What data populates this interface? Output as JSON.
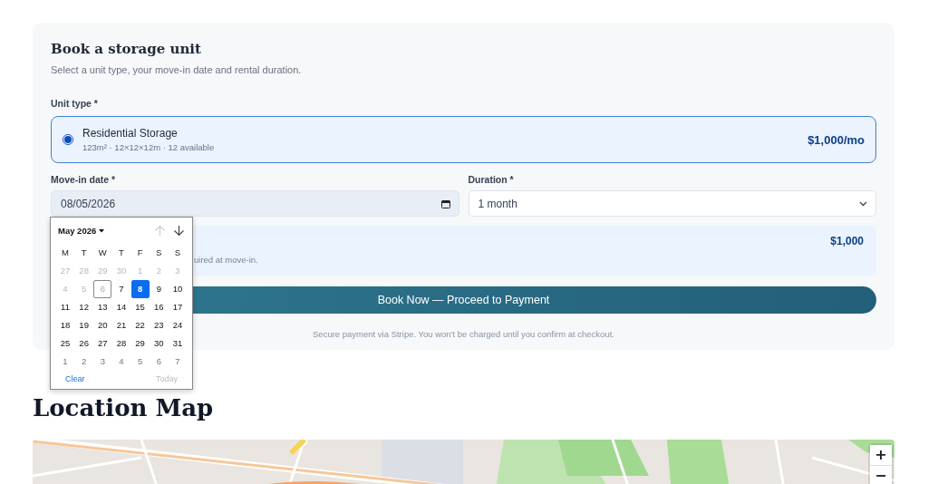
{
  "booking": {
    "title": "Book a storage unit",
    "subtitle": "Select a unit type, your move-in date and rental duration.",
    "unit_type": {
      "label": "Unit type *",
      "options": [
        {
          "name": "Residential Storage",
          "details": "123m² · 12×12×12m · 12 available",
          "price": "$1,000/mo",
          "selected": true
        }
      ]
    },
    "move_in": {
      "label": "Move-in date *",
      "value": "08/05/2026"
    },
    "duration": {
      "label": "Duration *",
      "value": "1 month"
    },
    "summary": {
      "note": "uired at move-in.",
      "total": "$1,000"
    },
    "submit": {
      "label": "Book Now — Proceed to Payment"
    },
    "footnote": "Secure payment via Stripe. You won't be charged until you confirm at checkout."
  },
  "calendar": {
    "month": "May 2026",
    "up_disabled": true,
    "down_disabled": false,
    "weekdays": [
      "M",
      "T",
      "W",
      "T",
      "F",
      "S",
      "S"
    ],
    "days": [
      {
        "label": "27",
        "kind": "disabled",
        "selected": false
      },
      {
        "label": "28",
        "kind": "disabled",
        "selected": false
      },
      {
        "label": "29",
        "kind": "disabled",
        "selected": false
      },
      {
        "label": "30",
        "kind": "disabled",
        "selected": false
      },
      {
        "label": "1",
        "kind": "disabled",
        "selected": false
      },
      {
        "label": "2",
        "kind": "disabled",
        "selected": false
      },
      {
        "label": "3",
        "kind": "disabled",
        "selected": false
      },
      {
        "label": "4",
        "kind": "disabled",
        "selected": false
      },
      {
        "label": "5",
        "kind": "disabled",
        "selected": false
      },
      {
        "label": "6",
        "kind": "today",
        "selected": false
      },
      {
        "label": "7",
        "kind": "normal",
        "selected": false
      },
      {
        "label": "8",
        "kind": "normal",
        "selected": true
      },
      {
        "label": "9",
        "kind": "normal",
        "selected": false
      },
      {
        "label": "10",
        "kind": "normal",
        "selected": false
      },
      {
        "label": "11",
        "kind": "normal",
        "selected": false
      },
      {
        "label": "12",
        "kind": "normal",
        "selected": false
      },
      {
        "label": "13",
        "kind": "normal",
        "selected": false
      },
      {
        "label": "14",
        "kind": "normal",
        "selected": false
      },
      {
        "label": "15",
        "kind": "normal",
        "selected": false
      },
      {
        "label": "16",
        "kind": "normal",
        "selected": false
      },
      {
        "label": "17",
        "kind": "normal",
        "selected": false
      },
      {
        "label": "18",
        "kind": "normal",
        "selected": false
      },
      {
        "label": "19",
        "kind": "normal",
        "selected": false
      },
      {
        "label": "20",
        "kind": "normal",
        "selected": false
      },
      {
        "label": "21",
        "kind": "normal",
        "selected": false
      },
      {
        "label": "22",
        "kind": "normal",
        "selected": false
      },
      {
        "label": "23",
        "kind": "normal",
        "selected": false
      },
      {
        "label": "24",
        "kind": "normal",
        "selected": false
      },
      {
        "label": "25",
        "kind": "normal",
        "selected": false
      },
      {
        "label": "26",
        "kind": "normal",
        "selected": false
      },
      {
        "label": "27",
        "kind": "normal",
        "selected": false
      },
      {
        "label": "28",
        "kind": "normal",
        "selected": false
      },
      {
        "label": "29",
        "kind": "normal",
        "selected": false
      },
      {
        "label": "30",
        "kind": "normal",
        "selected": false
      },
      {
        "label": "31",
        "kind": "normal",
        "selected": false
      },
      {
        "label": "1",
        "kind": "outside",
        "selected": false
      },
      {
        "label": "2",
        "kind": "outside",
        "selected": false
      },
      {
        "label": "3",
        "kind": "outside",
        "selected": false
      },
      {
        "label": "4",
        "kind": "outside",
        "selected": false
      },
      {
        "label": "5",
        "kind": "outside",
        "selected": false
      },
      {
        "label": "6",
        "kind": "outside",
        "selected": false
      },
      {
        "label": "7",
        "kind": "outside",
        "selected": false
      }
    ],
    "clear": {
      "label": "Clear",
      "disabled": false
    },
    "today": {
      "label": "Today",
      "disabled": true
    }
  },
  "map": {
    "title": "Location Map",
    "kind": "picture",
    "zoom_in": "+",
    "zoom_out": "−"
  }
}
